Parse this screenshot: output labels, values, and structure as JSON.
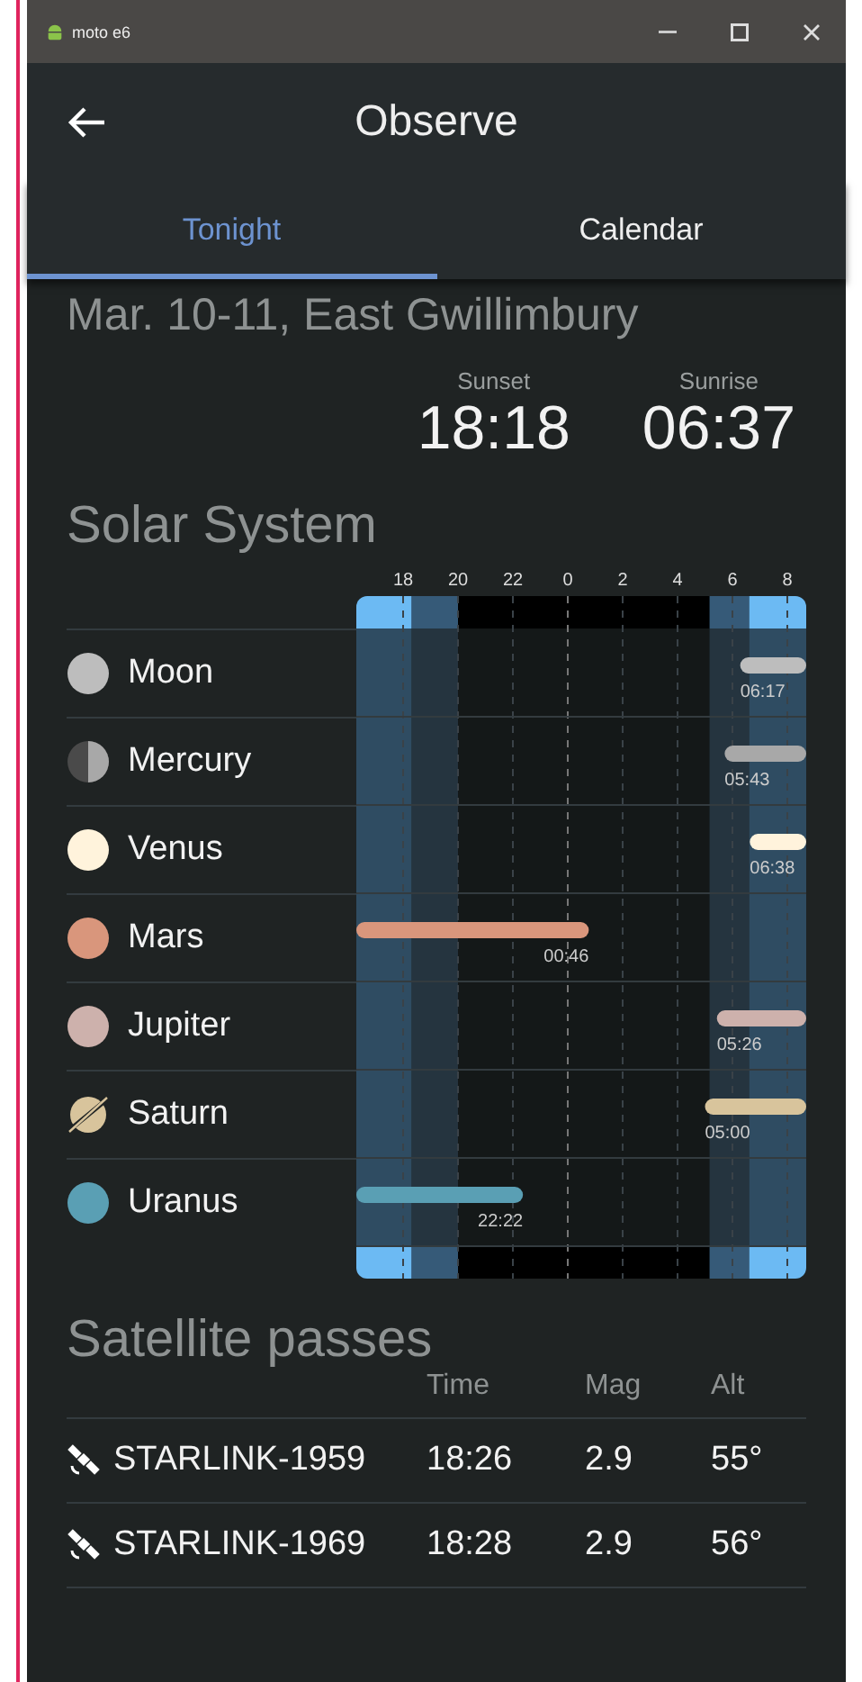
{
  "window": {
    "title": "moto e6"
  },
  "app_bar": {
    "title": "Observe"
  },
  "tabs": [
    {
      "label": "Tonight",
      "selected": true
    },
    {
      "label": "Calendar",
      "selected": false
    }
  ],
  "date_location": "Mar. 10-11, East Gwillimbury",
  "sun": [
    {
      "label": "Sunset",
      "time": "18:18"
    },
    {
      "label": "Sunrise",
      "time": "06:37"
    }
  ],
  "solar_system": {
    "heading": "Solar System",
    "axis_ticks": [
      "18",
      "20",
      "22",
      "0",
      "2",
      "4",
      "6",
      "8"
    ],
    "planets": [
      {
        "name": "Moon",
        "kind": "full",
        "color": "#bdbdbd",
        "rising": true,
        "time": "06:17"
      },
      {
        "name": "Mercury",
        "kind": "half",
        "color": "#a8a8a8",
        "rising": true,
        "time": "05:43"
      },
      {
        "name": "Venus",
        "kind": "full",
        "color": "#fff3dc",
        "rising": true,
        "time": "06:38"
      },
      {
        "name": "Mars",
        "kind": "full",
        "color": "#d9967c",
        "rising": false,
        "time": "00:46"
      },
      {
        "name": "Jupiter",
        "kind": "full",
        "color": "#cdb1ac",
        "rising": true,
        "time": "05:26"
      },
      {
        "name": "Saturn",
        "kind": "ringed",
        "color": "#d8c49c",
        "rising": true,
        "time": "05:00"
      },
      {
        "name": "Uranus",
        "kind": "full",
        "color": "#5a9fb4",
        "rising": false,
        "time": "22:22"
      }
    ]
  },
  "satellites": {
    "heading": "Satellite passes",
    "columns": [
      "Time",
      "Mag",
      "Alt"
    ],
    "rows": [
      {
        "name": "STARLINK-1959",
        "time": "18:26",
        "mag": "2.9",
        "alt": "55°"
      },
      {
        "name": "STARLINK-1969",
        "time": "18:28",
        "mag": "2.9",
        "alt": "56°"
      }
    ]
  }
}
